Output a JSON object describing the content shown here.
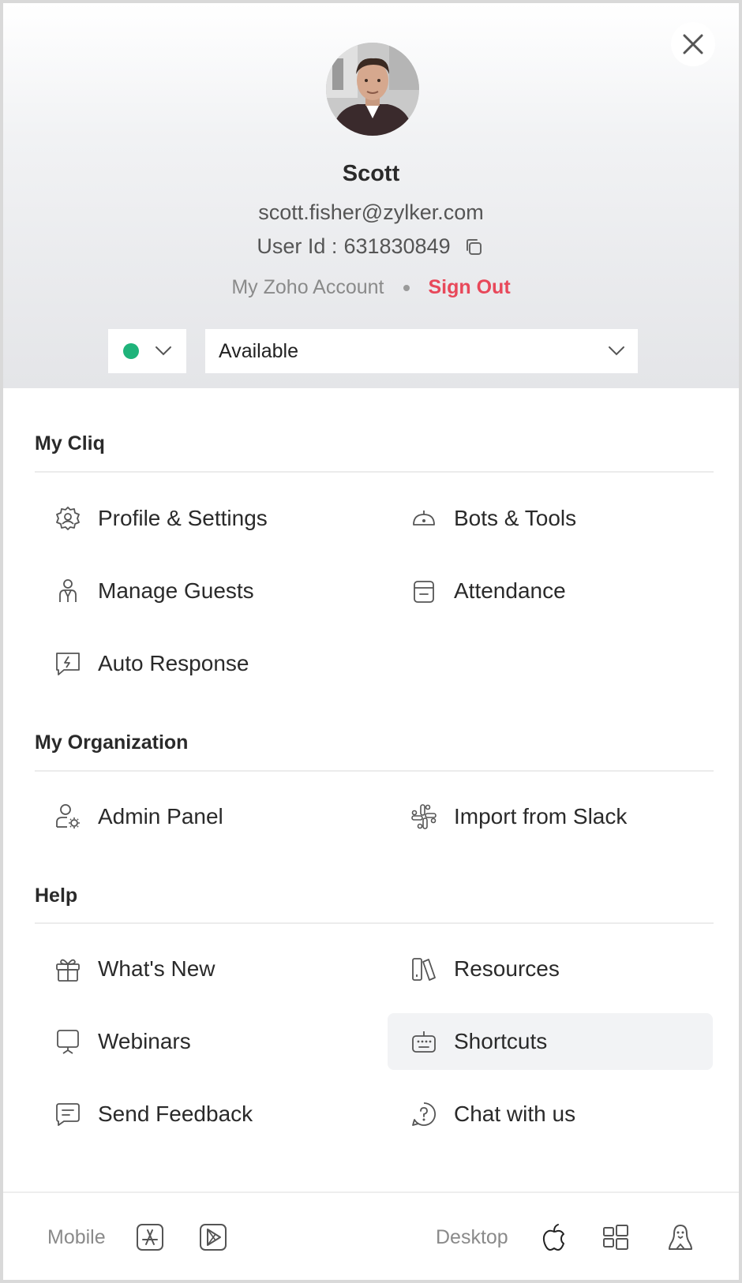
{
  "profile": {
    "name": "Scott",
    "email": "scott.fisher@zylker.com",
    "user_id_label": "User Id :",
    "user_id": "631830849",
    "my_account_label": "My Zoho Account",
    "sign_out_label": "Sign Out"
  },
  "status": {
    "presence": "online",
    "presence_color": "#1fb37a",
    "message": "Available"
  },
  "sections": {
    "my_cliq": {
      "title": "My Cliq",
      "items": {
        "profile_settings": "Profile & Settings",
        "bots_tools": "Bots & Tools",
        "manage_guests": "Manage Guests",
        "attendance": "Attendance",
        "auto_response": "Auto Response"
      }
    },
    "my_organization": {
      "title": "My Organization",
      "items": {
        "admin_panel": "Admin Panel",
        "import_slack": "Import from Slack"
      }
    },
    "help": {
      "title": "Help",
      "items": {
        "whats_new": "What's New",
        "resources": "Resources",
        "webinars": "Webinars",
        "shortcuts": "Shortcuts",
        "send_feedback": "Send Feedback",
        "chat_with_us": "Chat with us"
      }
    }
  },
  "footer": {
    "mobile_label": "Mobile",
    "desktop_label": "Desktop",
    "icons": [
      "app-store-icon",
      "play-store-icon",
      "apple-icon",
      "windows-icon",
      "linux-icon"
    ]
  },
  "colors": {
    "accent_red": "#e8485a",
    "online_green": "#1fb37a",
    "icon_gray": "#555555"
  }
}
